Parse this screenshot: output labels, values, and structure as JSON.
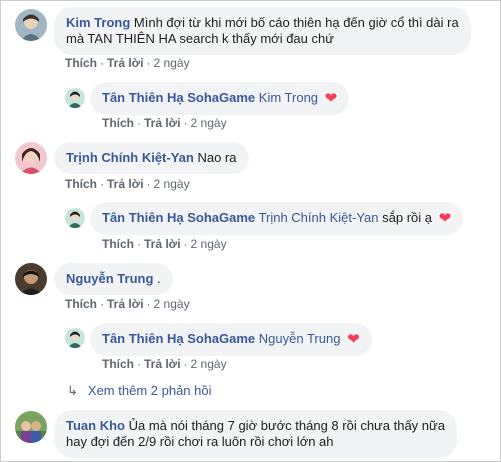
{
  "comments": [
    {
      "author": "Kim Trong",
      "text_line1": "Mình đợi từ khi mới bố cáo thiên hạ đến giờ cổ thì dài ra",
      "text_line2": "mà TAN THIÊN HA search k thấy mới đau chứ",
      "like": "Thích",
      "reply": "Trả lời",
      "time": "2 ngày",
      "reply_item": {
        "author": "Tân Thiên Hạ SohaGame",
        "mention": "Kim Trong",
        "text": "",
        "like": "Thích",
        "reply": "Trả lời",
        "time": "2 ngày"
      }
    },
    {
      "author": "Trịnh Chính Kiệt-Yan",
      "text_line1": "Nao ra",
      "like": "Thích",
      "reply": "Trả lời",
      "time": "2 ngày",
      "reply_item": {
        "author": "Tân Thiên Hạ SohaGame",
        "mention": "Trịnh Chính Kiệt-Yan",
        "text": "sắp rồi ạ",
        "like": "Thích",
        "reply": "Trả lời",
        "time": "2 ngày"
      }
    },
    {
      "author": "Nguyễn Trung",
      "text_line1": ".",
      "like": "Thích",
      "reply": "Trả lời",
      "time": "2 ngày",
      "reply_item": {
        "author": "Tân Thiên Hạ SohaGame",
        "mention": "Nguyễn Trung",
        "text": "",
        "like": "Thích",
        "reply": "Trả lời",
        "time": "2 ngày"
      }
    },
    {
      "author": "Tuan Kho",
      "text_line1": "Ủa mà nói tháng 7 giờ bước tháng 8 rồi chưa thấy nữa",
      "text_line2": "hay đợi đến 2/9 rồi chơi ra luôn rồi chơi lớn ah"
    }
  ],
  "more_replies": "Xem thêm 2 phản hồi",
  "reaction_icon": "heart-icon",
  "colors": {
    "link": "#385898",
    "bubble": "#f2f3f5",
    "meta": "#606770",
    "heart": "#f33e58"
  }
}
